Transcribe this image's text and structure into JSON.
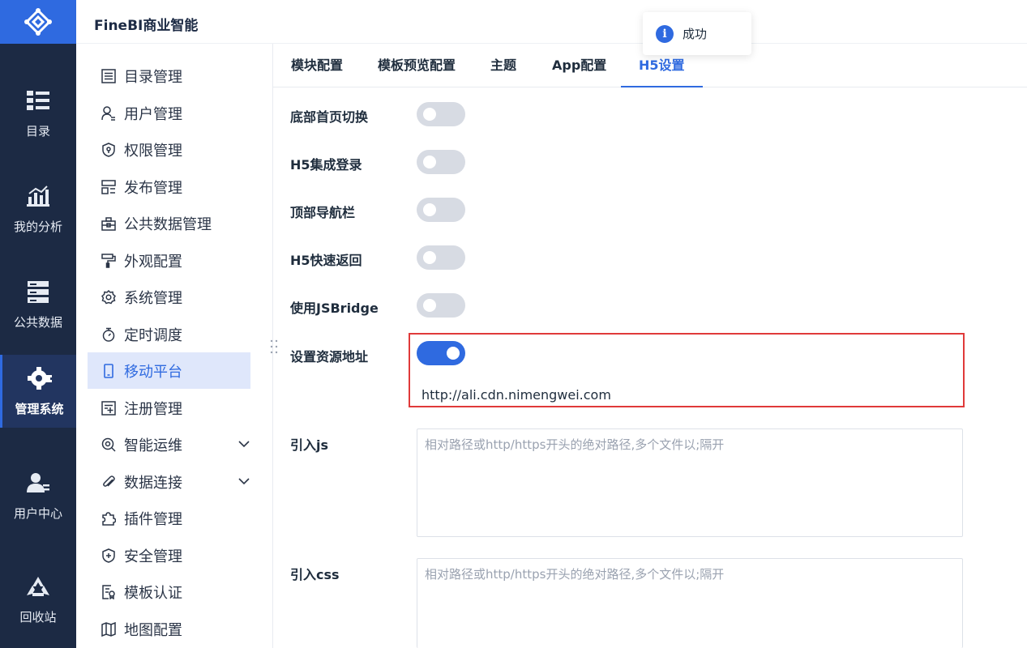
{
  "app": {
    "title": "FineBI商业智能"
  },
  "toast": {
    "text": "成功",
    "icon": "info-icon"
  },
  "rail": {
    "items": [
      {
        "label": "目录",
        "icon": "catalog-icon"
      },
      {
        "label": "我的分析",
        "icon": "analysis-chart-icon"
      },
      {
        "label": "公共数据",
        "icon": "database-icon"
      },
      {
        "label": "管理系统",
        "icon": "gear-icon",
        "active": true
      },
      {
        "label": "用户中心",
        "icon": "user-center-icon"
      },
      {
        "label": "回收站",
        "icon": "recycle-icon"
      }
    ]
  },
  "menu": {
    "items": [
      {
        "label": "目录管理",
        "icon": "list-icon"
      },
      {
        "label": "用户管理",
        "icon": "user-icon"
      },
      {
        "label": "权限管理",
        "icon": "shield-lock-icon"
      },
      {
        "label": "发布管理",
        "icon": "publish-icon"
      },
      {
        "label": "公共数据管理",
        "icon": "briefcase-icon"
      },
      {
        "label": "外观配置",
        "icon": "paint-roller-icon"
      },
      {
        "label": "系统管理",
        "icon": "gear-icon"
      },
      {
        "label": "定时调度",
        "icon": "stopwatch-icon"
      },
      {
        "label": "移动平台",
        "icon": "mobile-icon",
        "active": true
      },
      {
        "label": "注册管理",
        "icon": "register-icon"
      },
      {
        "label": "智能运维",
        "icon": "ops-icon",
        "expandable": true
      },
      {
        "label": "数据连接",
        "icon": "paperclip-icon",
        "expandable": true
      },
      {
        "label": "插件管理",
        "icon": "puzzle-icon"
      },
      {
        "label": "安全管理",
        "icon": "shield-plus-icon"
      },
      {
        "label": "模板认证",
        "icon": "template-cert-icon"
      },
      {
        "label": "地图配置",
        "icon": "map-icon"
      }
    ]
  },
  "tabs": [
    {
      "label": "模块配置"
    },
    {
      "label": "模板预览配置"
    },
    {
      "label": "主题"
    },
    {
      "label": "App配置"
    },
    {
      "label": "H5设置",
      "active": true
    }
  ],
  "settings": {
    "bottom_home_switch": {
      "label": "底部首页切换",
      "on": false
    },
    "h5_sso_login": {
      "label": "H5集成登录",
      "on": false
    },
    "top_nav_bar": {
      "label": "顶部导航栏",
      "on": false
    },
    "h5_quick_back": {
      "label": "H5快速返回",
      "on": false
    },
    "use_jsbridge": {
      "label": "使用JSBridge",
      "on": false
    },
    "resource_address": {
      "label": "设置资源地址",
      "on": true,
      "value": "http://ali.cdn.nimengwei.com"
    },
    "import_js": {
      "label": "引入js",
      "placeholder": "相对路径或http/https开头的绝对路径,多个文件以;隔开"
    },
    "import_css": {
      "label": "引入css",
      "placeholder": "相对路径或http/https开头的绝对路径,多个文件以;隔开"
    }
  },
  "colors": {
    "accent": "#2f6ae0",
    "rail_bg": "#1c2a44",
    "highlight": "#e03a3a"
  }
}
